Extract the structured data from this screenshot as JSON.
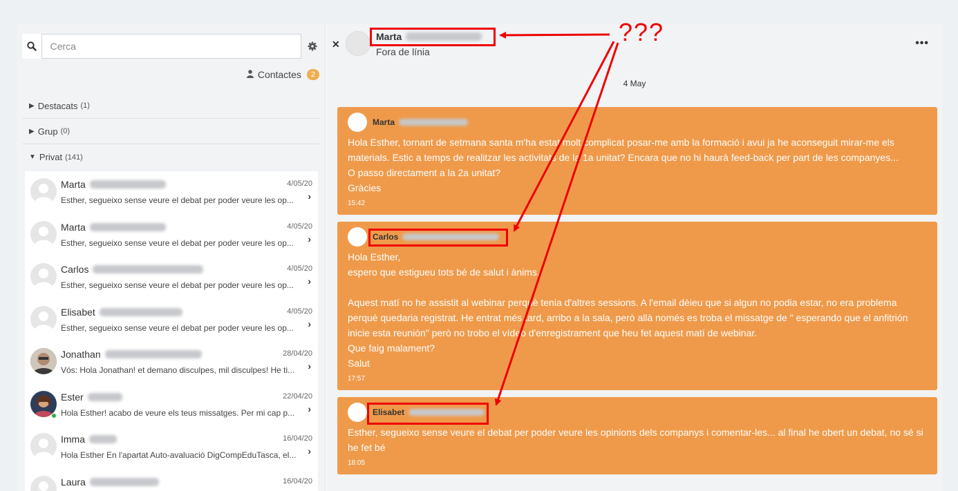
{
  "search": {
    "placeholder": "Cerca"
  },
  "contacts": {
    "label": "Contactes",
    "count": "2"
  },
  "sections": [
    {
      "label": "Destacats",
      "count": "(1)"
    },
    {
      "label": "Grup",
      "count": "(0)"
    },
    {
      "label": "Privat",
      "count": "(141)"
    }
  ],
  "conversations": [
    {
      "name": "Marta",
      "date": "4/05/20",
      "preview": "Esther, segueixo sense veure el debat per poder veure les op..."
    },
    {
      "name": "Marta",
      "date": "4/05/20",
      "preview": "Esther, segueixo sense veure el debat per poder veure les op..."
    },
    {
      "name": "Carlos",
      "date": "4/05/20",
      "preview": "Esther, segueixo sense veure el debat per poder veure les op..."
    },
    {
      "name": "Elisabet",
      "date": "4/05/20",
      "preview": "Esther, segueixo sense veure el debat per poder veure les op..."
    },
    {
      "name": "Jonathan",
      "date": "28/04/20",
      "preview": "Vós: Hola Jonathan! et demano disculpes, mil disculpes! He ti..."
    },
    {
      "name": "Ester",
      "date": "22/04/20",
      "preview": "Hola Esther! acabo de veure els teus missatges. Per mi cap p..."
    },
    {
      "name": "Imma",
      "date": "16/04/20",
      "preview": "Hola Esther En l'apartat Auto-avaluació DigCompEduTasca, el..."
    },
    {
      "name": "Laura",
      "date": "16/04/20",
      "preview": ""
    }
  ],
  "header": {
    "name": "Marta",
    "status": "Fora de línia"
  },
  "day": "4 May",
  "messages": [
    {
      "name": "Marta",
      "text": "Hola Esther, tornant de setmana santa m'ha estat molt complicat posar-me amb la formació i avui ja he aconseguit mirar-me els materials. Estic a temps de realitzar les activitats de la 1a unitat? Encara que no hi haurà feed-back per part de les companyes...\nO passo directament a la 2a unitat?\nGràcies",
      "time": "15:42"
    },
    {
      "name": "Carlos",
      "text": "Hola Esther,\nespero que estigueu tots bé de salut i ànims.\n\nAquest matí no he assistit al webinar perquè tenia d'altres sessions. A l'email dèieu que si algun no podia estar, no era problema perquè quedaria registrat. He entrat més tard, arribo a la sala, però allà només es troba el missatge de \" esperando que el anfitrión inicie esta reunión\" però no trobo el vídeo d'enregistrament que heu fet aquest matí de webinar.\nQue faig malament?\nSalut",
      "time": "17:57"
    },
    {
      "name": "Elisabet",
      "text": "Esther, segueixo sense veure el debat per poder veure les opinions dels companys i comentar-les... al final he obert un debat, no sé si he fet bé",
      "time": "18:05"
    }
  ],
  "annotation": {
    "text": "???",
    "color": "#e00000"
  }
}
